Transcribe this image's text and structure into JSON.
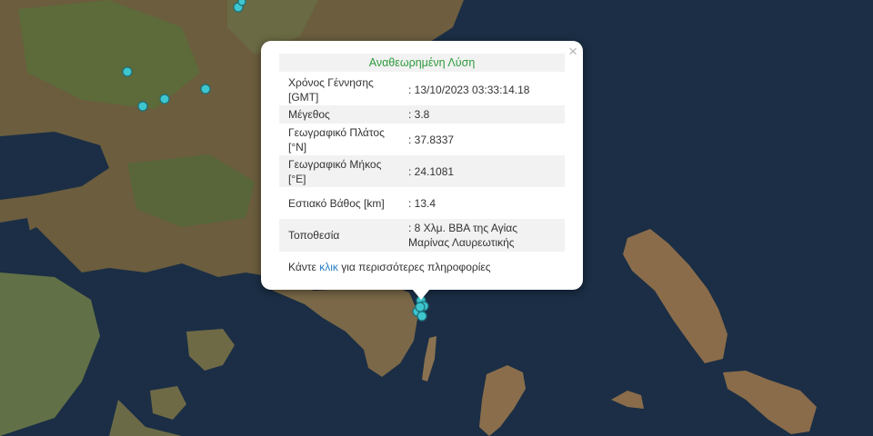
{
  "popup": {
    "title": "Αναθεωρημένη Λύση",
    "close_label": "×",
    "rows": [
      {
        "label": "Χρόνος Γέννησης [GMT]",
        "value": ": 13/10/2023 03:33:14.18"
      },
      {
        "label": "Μέγεθος",
        "value": ": 3.8"
      },
      {
        "label": "Γεωγραφικό Πλάτος [°N]",
        "value": ": 37.8337"
      },
      {
        "label": "Γεωγραφικό Μήκος [°E]",
        "value": ": 24.1081"
      },
      {
        "label": "Εστιακό Βάθος [km]",
        "value": ": 13.4"
      },
      {
        "label": "Τοποθεσία",
        "value": ": 8 Χλμ. ΒΒΑ της Αγίας Μαρίνας Λαυρεωτικής"
      }
    ],
    "footer": {
      "prefix": "Κάντε ",
      "link": "κλικ",
      "suffix": " για περισσότερες πληροφορίες"
    }
  },
  "colors": {
    "sea": "#1b2e45",
    "land": "#6b5d3e",
    "quake_marker": "#3ec6cf",
    "title_text": "#2f9a3c",
    "link": "#2a7ec7"
  },
  "map": {
    "marker_icon": "earthquake-marker-icon"
  }
}
